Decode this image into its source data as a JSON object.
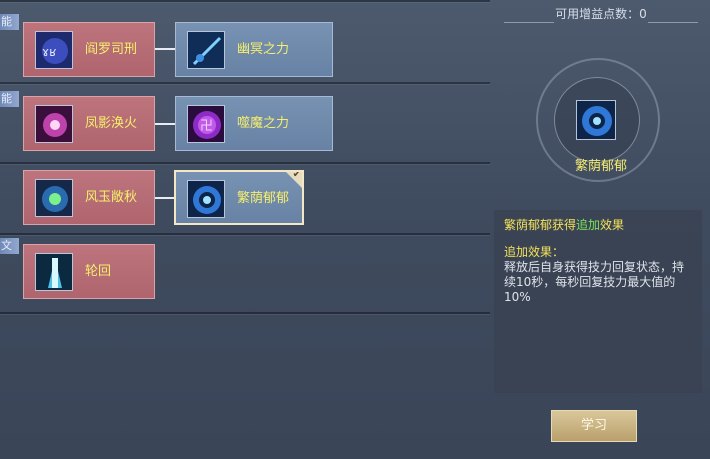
{
  "left": {
    "row_labels": [
      "能",
      "能",
      "",
      "文"
    ],
    "rows": [
      {
        "nodes": [
          {
            "label": "阎罗司刑",
            "color": "red",
            "icon": "purple-runes-icon"
          },
          {
            "label": "幽冥之力",
            "color": "blue",
            "icon": "blue-spear-icon"
          }
        ]
      },
      {
        "nodes": [
          {
            "label": "凤影涣火",
            "color": "red",
            "icon": "pink-burst-icon"
          },
          {
            "label": "噬魔之力",
            "color": "blue",
            "icon": "purple-glyph-icon"
          }
        ]
      },
      {
        "nodes": [
          {
            "label": "风玉敞秋",
            "color": "red",
            "icon": "green-orb-icon"
          },
          {
            "label": "繁荫郁郁",
            "color": "blue",
            "icon": "blue-vortex-icon",
            "selected": true
          }
        ]
      },
      {
        "nodes": [
          {
            "label": "轮回",
            "color": "red",
            "icon": "cyan-beam-icon"
          }
        ]
      }
    ]
  },
  "right": {
    "points_label": "可用增益点数：0",
    "selected_skill": {
      "name": "繁荫郁郁",
      "icon": "blue-vortex-icon"
    },
    "desc": {
      "title_prefix": "繁荫郁郁获得",
      "title_highlight": "追加",
      "title_suffix": "效果",
      "sub_title": "追加效果：",
      "body": "释放后自身获得技力回复状态，持续10秒，每秒回复技力最大值的10%"
    },
    "learn_button": "学习"
  },
  "colors": {
    "red_card": "#b86c75",
    "blue_card": "#7089ac",
    "label_yellow": "#f7ef6b",
    "highlight_green": "#7ae35a"
  }
}
